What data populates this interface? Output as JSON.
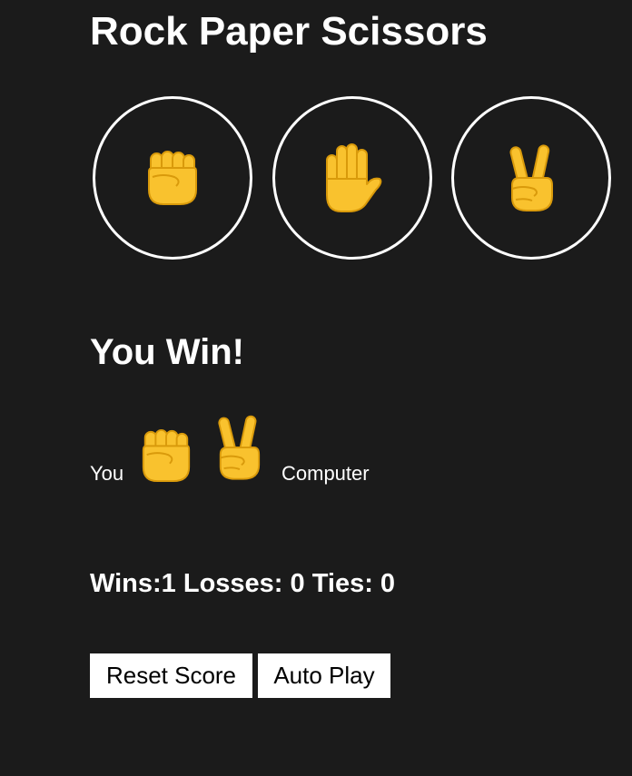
{
  "title": "Rock Paper Scissors",
  "moves": [
    {
      "name": "rock",
      "icon": "raised-fist-icon"
    },
    {
      "name": "paper",
      "icon": "raised-hand-icon"
    },
    {
      "name": "scissors",
      "icon": "victory-hand-icon"
    }
  ],
  "result": {
    "text": "You Win!",
    "you_label": "You",
    "computer_label": "Computer",
    "you_pick_icon": "raised-fist-icon",
    "computer_pick_icon": "victory-hand-icon"
  },
  "score": {
    "text": "Wins:1 Losses: 0 Ties: 0",
    "wins": 1,
    "losses": 0,
    "ties": 0
  },
  "buttons": {
    "reset_label": "Reset Score",
    "auto_play_label": "Auto Play"
  },
  "colors": {
    "background": "#1b1b1b",
    "text": "#ffffff",
    "emoji": "#f9c22e",
    "emoji_line": "#d99a0b",
    "button_bg": "#ffffff",
    "button_text": "#000000"
  }
}
